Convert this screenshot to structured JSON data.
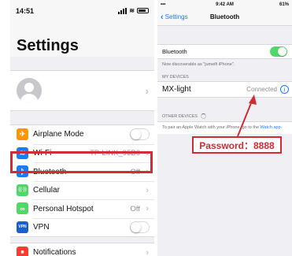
{
  "left": {
    "status": {
      "time": "14:51"
    },
    "title": "Settings",
    "rows": [
      {
        "label": "Airplane Mode",
        "value": "",
        "color": "#ff9500",
        "glyph": "✈",
        "icon": "airplane-icon",
        "toggle": true
      },
      {
        "label": "Wi-Fi",
        "value": "TP-LINK_95B6",
        "color": "#1a7bff",
        "glyph": "≋",
        "icon": "wifi-icon",
        "toggle": false
      },
      {
        "label": "Bluetooth",
        "value": "Off",
        "color": "#1a7bff",
        "glyph": "ᛒ",
        "icon": "bluetooth-icon",
        "toggle": false
      },
      {
        "label": "Cellular",
        "value": "",
        "color": "#4cd964",
        "glyph": "((·))",
        "icon": "cellular-icon",
        "toggle": false
      },
      {
        "label": "Personal Hotspot",
        "value": "Off",
        "color": "#4cd964",
        "glyph": "∞",
        "icon": "hotspot-icon",
        "toggle": false
      },
      {
        "label": "VPN",
        "value": "",
        "color": "#1a5fcf",
        "glyph": "VPN",
        "icon": "vpn-icon",
        "toggle": true
      }
    ],
    "notifications": {
      "label": "Notifications",
      "color": "#ff3b30",
      "glyph": "■"
    }
  },
  "right": {
    "status": {
      "carrier": "•••",
      "time": "9:42 AM",
      "battery": "61%"
    },
    "nav": {
      "back": "Settings",
      "title": "Bluetooth"
    },
    "bluetooth_label": "Bluetooth",
    "discoverable_text": "Now discoverable as \"jumeifi iPhone\".",
    "my_devices_header": "MY DEVICES",
    "device": {
      "name": "MX-light",
      "status": "Connected"
    },
    "other_devices_header": "OTHER DEVICES",
    "watch_text": "To pair an Apple Watch with your iPhone, go to the",
    "watch_link": "Watch app."
  },
  "password_callout": "Password：8888",
  "colors": {
    "highlight": "#d42a35",
    "accent": "#1a7bff",
    "toggle_on": "#4cd964"
  }
}
